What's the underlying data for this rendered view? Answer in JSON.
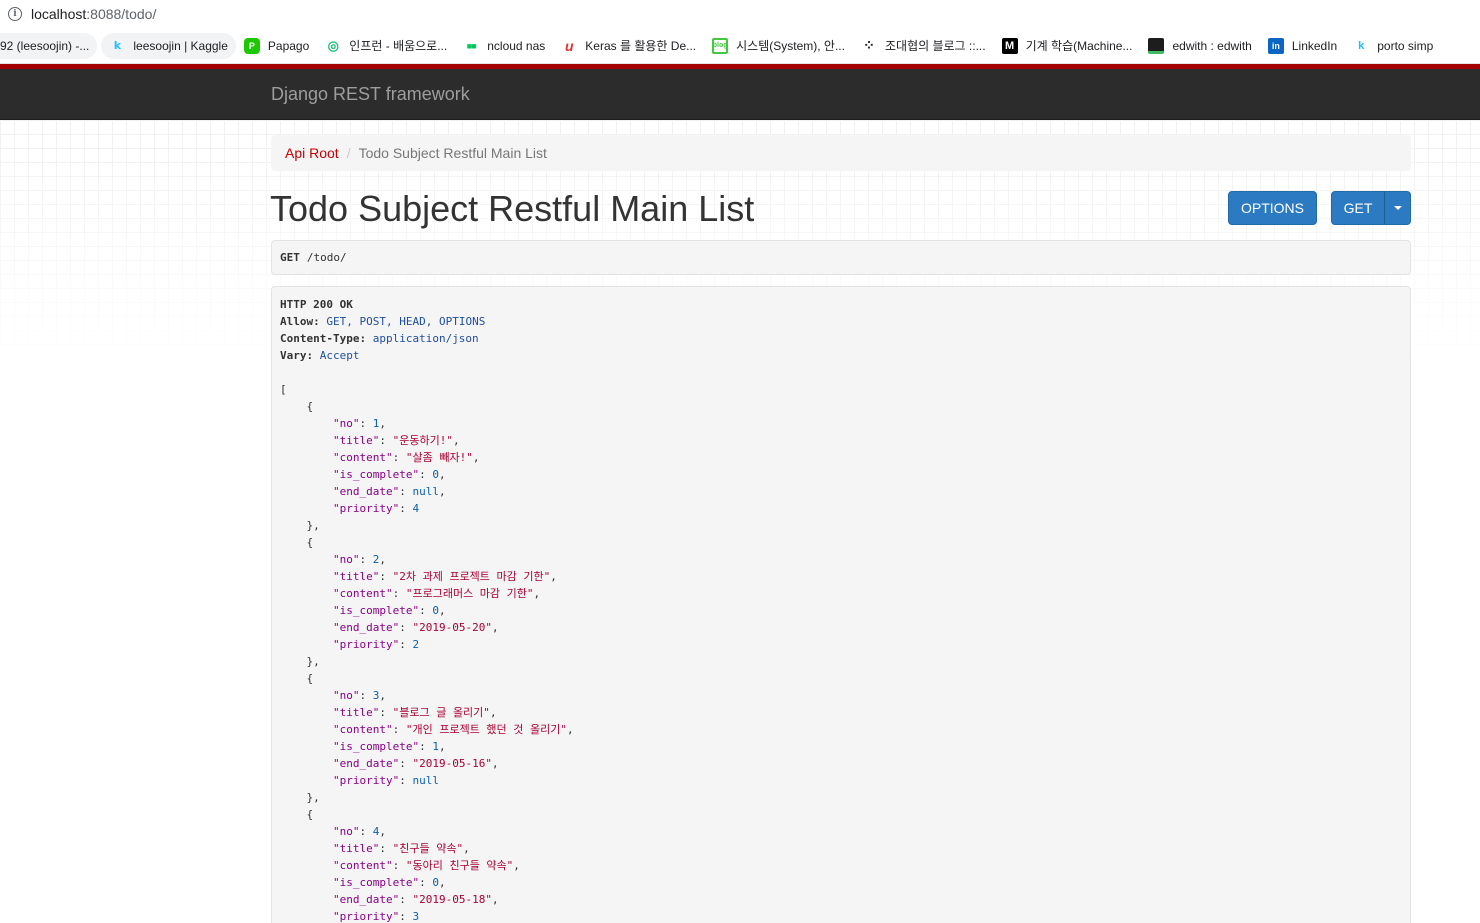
{
  "browser": {
    "url_host": "localhost",
    "url_rest": ":8088/todo/",
    "bookmarks": [
      {
        "label": "92 (leesoojin) -...",
        "icon": "",
        "icon_color": "#444444"
      },
      {
        "label": "leesoojin | Kaggle",
        "icon": "k",
        "icon_color": "#20beff"
      },
      {
        "label": "Papago",
        "icon": "P",
        "icon_color": "#1ec800"
      },
      {
        "label": "인프런 - 배움으로...",
        "icon": "◎",
        "icon_color": "#1dc078"
      },
      {
        "label": "ncloud nas",
        "icon": "■■",
        "icon_color": "#03c75a"
      },
      {
        "label": "Keras 를 활용한 De...",
        "icon": "u",
        "icon_color": "#e8342e"
      },
      {
        "label": "시스템(System), 안...",
        "icon": "b",
        "icon_color": "#43c73f"
      },
      {
        "label": "조대협의 블로그 ::...",
        "icon": "⁘",
        "icon_color": "#222222"
      },
      {
        "label": "기계 학습(Machine...",
        "icon": "M",
        "icon_color": "#000000"
      },
      {
        "label": "edwith : edwith",
        "icon": "▬",
        "icon_color": "#1d1d1d"
      },
      {
        "label": "LinkedIn",
        "icon": "in",
        "icon_color": "#0a66c2"
      },
      {
        "label": "porto simp",
        "icon": "k",
        "icon_color": "#20beff"
      }
    ]
  },
  "navbar": {
    "brand": "Django REST framework"
  },
  "breadcrumb": {
    "root": "Api Root",
    "separator": "/",
    "current": "Todo Subject Restful Main List"
  },
  "page": {
    "title": "Todo Subject Restful Main List"
  },
  "buttons": {
    "options": "OPTIONS",
    "get": "GET"
  },
  "request": {
    "method": "GET",
    "path": "/todo/"
  },
  "response": {
    "status": "HTTP 200 OK",
    "headers": [
      {
        "key": "Allow:",
        "value": "GET, POST, HEAD, OPTIONS"
      },
      {
        "key": "Content-Type:",
        "value": "application/json"
      },
      {
        "key": "Vary:",
        "value": "Accept"
      }
    ],
    "items": [
      {
        "no": "1",
        "title": "\"운동하기!\"",
        "content": "\"살좀 빼자!\"",
        "is_complete": "0",
        "end_date": "null",
        "priority": "4"
      },
      {
        "no": "2",
        "title": "\"2차 과제 프로젝트 마감 기한\"",
        "content": "\"프로그래머스 마감 기한\"",
        "is_complete": "0",
        "end_date": "\"2019-05-20\"",
        "priority": "2"
      },
      {
        "no": "3",
        "title": "\"블로그 글 올리기\"",
        "content": "\"개인 프로젝트 했던 것 올리기\"",
        "is_complete": "1",
        "end_date": "\"2019-05-16\"",
        "priority": "null"
      },
      {
        "no": "4",
        "title": "\"친구들 약속\"",
        "content": "\"동아리 친구들 약속\"",
        "is_complete": "0",
        "end_date": "\"2019-05-18\"",
        "priority": "3"
      }
    ]
  }
}
